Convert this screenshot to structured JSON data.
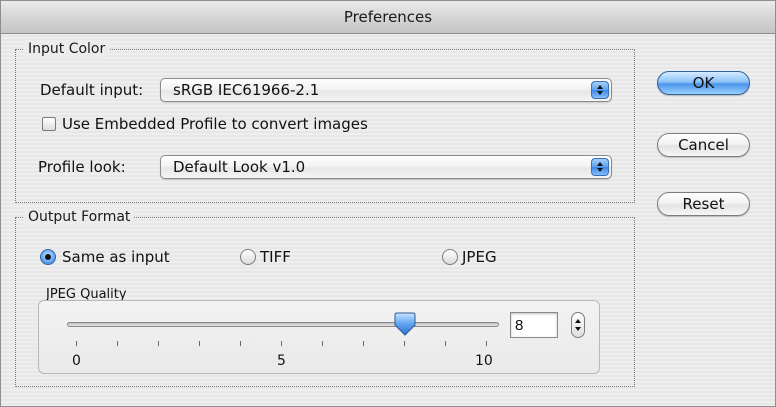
{
  "window": {
    "title": "Preferences"
  },
  "input_color": {
    "legend": "Input Color",
    "default_input_label": "Default input:",
    "default_input_value": "sRGB IEC61966-2.1",
    "embed_checkbox_label": "Use Embedded Profile to convert images",
    "embed_checkbox_checked": false,
    "profile_look_label": "Profile look:",
    "profile_look_value": "Default Look v1.0"
  },
  "output_format": {
    "legend": "Output Format",
    "options": [
      {
        "label": "Same as input",
        "selected": true
      },
      {
        "label": "TIFF",
        "selected": false
      },
      {
        "label": "JPEG",
        "selected": false
      }
    ],
    "jpeg_quality_label": "JPEG Quality",
    "jpeg_quality_value": "8",
    "jpeg_quality_min": 0,
    "jpeg_quality_max": 10,
    "tick_labels": [
      "0",
      "5",
      "10"
    ]
  },
  "buttons": {
    "ok": "OK",
    "cancel": "Cancel",
    "reset": "Reset"
  },
  "colors": {
    "accent": "#4c95ea",
    "window_bg": "#ececec"
  }
}
